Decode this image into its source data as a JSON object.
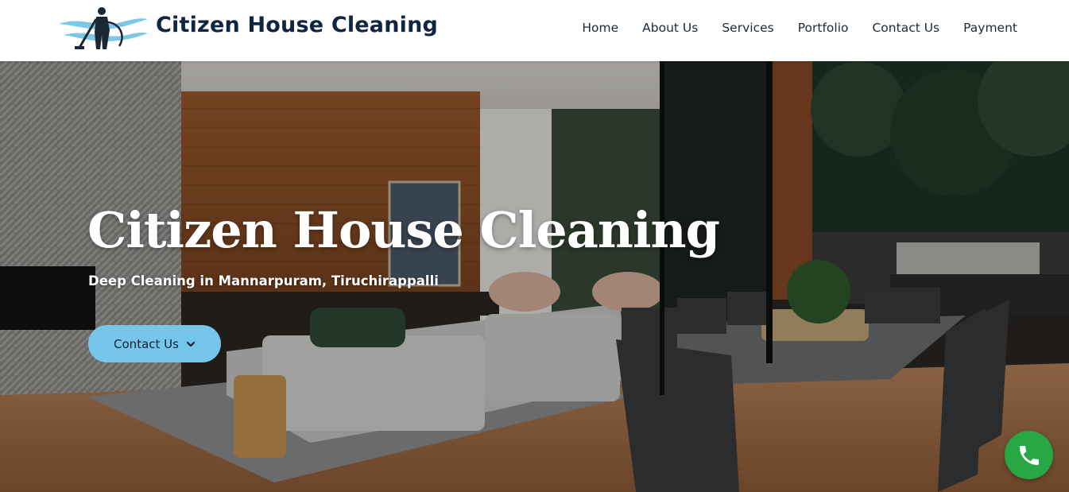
{
  "header": {
    "brand": "Citizen House Cleaning",
    "nav": [
      "Home",
      "About Us",
      "Services",
      "Portfolio",
      "Contact Us",
      "Payment"
    ]
  },
  "hero": {
    "title": "Citizen House Cleaning",
    "subtitle": "Deep Cleaning in Mannarpuram, Tiruchirappalli",
    "cta_label": "Contact Us"
  },
  "icons": {
    "logo": "vacuum-cleaner-person-logo",
    "cta": "chevron-down-icon",
    "call": "phone-icon"
  },
  "colors": {
    "brand_text": "#0f2540",
    "cta_bg": "#76c6ea",
    "call_bg": "#27a844"
  }
}
